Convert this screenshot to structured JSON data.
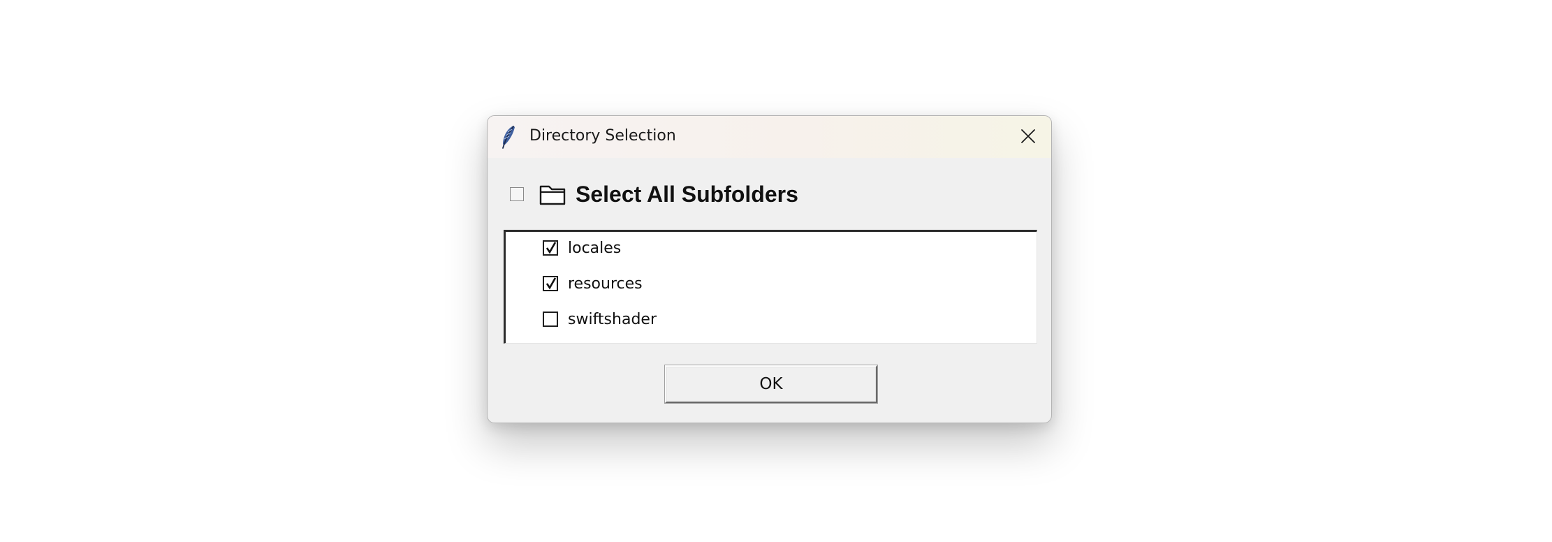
{
  "window": {
    "title": "Directory Selection",
    "app_icon": "feather-icon",
    "close_icon": "close-icon"
  },
  "select_all": {
    "label": "Select All Subfolders",
    "checked": false,
    "icon": "folder-icon"
  },
  "subfolders": [
    {
      "label": "locales",
      "checked": true
    },
    {
      "label": "resources",
      "checked": true
    },
    {
      "label": "swiftshader",
      "checked": false
    }
  ],
  "actions": {
    "ok_label": "OK"
  },
  "colors": {
    "dialog_bg": "#f0f0f0",
    "list_bg": "#ffffff",
    "text": "#111111",
    "feather": "#3f5f9f"
  }
}
